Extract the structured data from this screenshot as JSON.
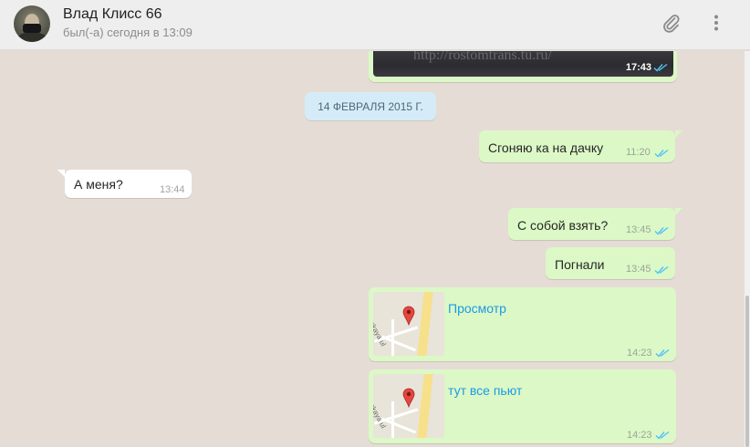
{
  "header": {
    "contact_name": "Влад Клисс 66",
    "status": "был(-а) сегодня в 13:09",
    "icons": {
      "attach": "paperclip-icon",
      "menu": "vertical-dots-icon"
    }
  },
  "colors": {
    "header_bg": "#eeeeee",
    "chat_bg": "#e5ddd5",
    "outgoing_bubble": "#dcf8c6",
    "incoming_bubble": "#ffffff",
    "date_pill": "#d5ecf8",
    "read_ticks": "#4fc3f7",
    "link": "#1a9be6"
  },
  "chat": {
    "photo_message": {
      "watermark": "http://rostomtrans.tu.ru/",
      "time": "17:43",
      "status": "read"
    },
    "date_divider": "14 ФЕВРАЛЯ 2015 Г.",
    "messages": [
      {
        "direction": "out",
        "text": "Сгоняю ка на дачку",
        "time": "11:20",
        "status": "read"
      },
      {
        "direction": "in",
        "text": "А меня?",
        "time": "13:44"
      },
      {
        "direction": "out",
        "text": "С собой взять?",
        "time": "13:45",
        "status": "read"
      },
      {
        "direction": "out",
        "text": "Погнали",
        "time": "13:45",
        "status": "read"
      }
    ],
    "location_messages": [
      {
        "link_text": "Просмотр",
        "map_street": "ttsevskaya ul",
        "time": "14:23",
        "status": "read"
      },
      {
        "link_text": "тут все пьют",
        "map_street": "ttsevskaya ul",
        "time": "14:23",
        "status": "read"
      }
    ]
  }
}
